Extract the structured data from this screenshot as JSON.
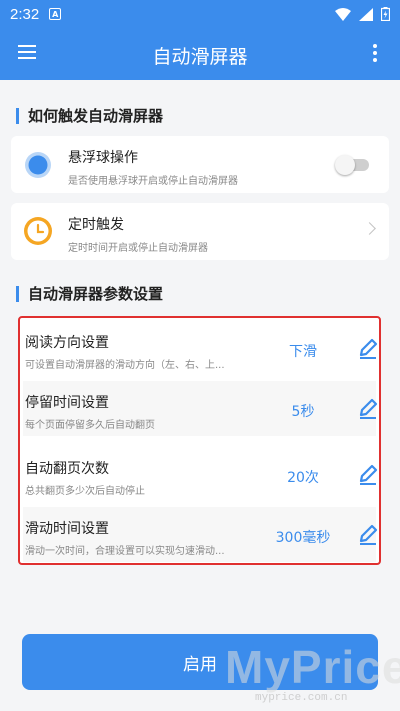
{
  "status_bar": {
    "time": "2:32",
    "notification": "A"
  },
  "app_bar": {
    "title": "自动滑屏器"
  },
  "trigger_section": {
    "title": "如何触发自动滑屏器",
    "items": [
      {
        "title": "悬浮球操作",
        "subtitle": "是否使用悬浮球开启或停止自动滑屏器",
        "toggle_on": false
      },
      {
        "title": "定时触发",
        "subtitle": "定时时间开启或停止自动滑屏器"
      }
    ]
  },
  "params_section": {
    "title": "自动滑屏器参数设置",
    "items": [
      {
        "title": "阅读方向设置",
        "subtitle": "可设置自动滑屏器的滑动方向（左、右、上...",
        "value": "下滑"
      },
      {
        "title": "停留时间设置",
        "subtitle": "每个页面停留多久后自动翻页",
        "value": "5秒"
      },
      {
        "title": "自动翻页次数",
        "subtitle": "总共翻页多少次后自动停止",
        "value": "20次"
      },
      {
        "title": "滑动时间设置",
        "subtitle": "滑动一次时间，合理设置可以实现匀速滑动...",
        "value": "300毫秒"
      }
    ]
  },
  "enable_button": {
    "label": "启用"
  },
  "watermark": {
    "text": "MyPrice",
    "sub": "myprice.com.cn"
  },
  "colors": {
    "primary": "#3b8cec",
    "highlight_border": "#e03030",
    "clock_orange": "#f5a623"
  }
}
